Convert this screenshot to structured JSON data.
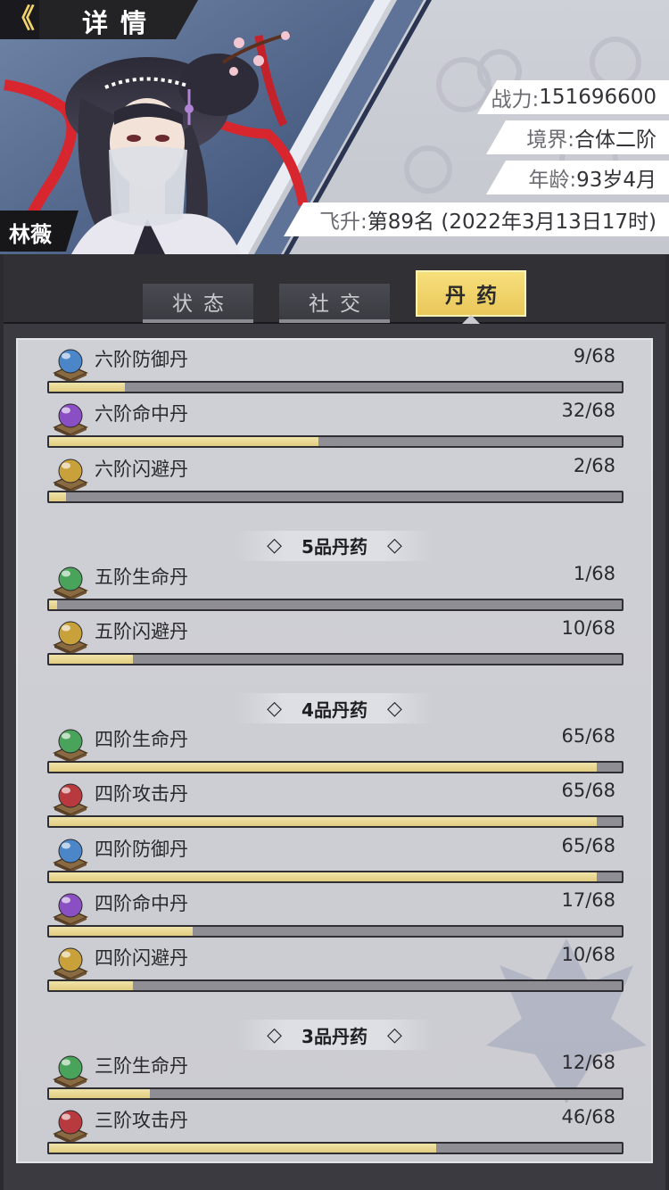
{
  "header": {
    "back_glyph": "《",
    "title": "详情",
    "character_name": "林薇",
    "stats": {
      "power_label": "战力:",
      "power_value": "151696600",
      "realm_label": "境界:",
      "realm_value": "合体二阶",
      "age_label": "年龄:",
      "age_value": "93岁4月",
      "ascend_label": "飞升:",
      "ascend_value": "第89名 (2022年3月13日17时)"
    }
  },
  "tabs": [
    {
      "label": "状态",
      "active": false
    },
    {
      "label": "社交",
      "active": false
    },
    {
      "label": "丹药",
      "active": true
    }
  ],
  "sections": [
    {
      "title": "",
      "items": [
        {
          "name": "六阶防御丹",
          "count": "9/68",
          "current": 9,
          "max": 68,
          "orb": "blue-pill-icon",
          "color": "#4a86c8"
        },
        {
          "name": "六阶命中丹",
          "count": "32/68",
          "current": 32,
          "max": 68,
          "orb": "purple-pill-icon",
          "color": "#8a4fc2"
        },
        {
          "name": "六阶闪避丹",
          "count": "2/68",
          "current": 2,
          "max": 68,
          "orb": "gold-pill-icon",
          "color": "#c9a13a"
        }
      ]
    },
    {
      "title": "5品丹药",
      "items": [
        {
          "name": "五阶生命丹",
          "count": "1/68",
          "current": 1,
          "max": 68,
          "orb": "green-pill-icon",
          "color": "#4aa35a"
        },
        {
          "name": "五阶闪避丹",
          "count": "10/68",
          "current": 10,
          "max": 68,
          "orb": "gold-pill-icon",
          "color": "#c9a13a"
        }
      ]
    },
    {
      "title": "4品丹药",
      "items": [
        {
          "name": "四阶生命丹",
          "count": "65/68",
          "current": 65,
          "max": 68,
          "orb": "green-pill-icon",
          "color": "#4aa35a"
        },
        {
          "name": "四阶攻击丹",
          "count": "65/68",
          "current": 65,
          "max": 68,
          "orb": "red-pill-icon",
          "color": "#b83a3e"
        },
        {
          "name": "四阶防御丹",
          "count": "65/68",
          "current": 65,
          "max": 68,
          "orb": "blue-pill-icon",
          "color": "#4a86c8"
        },
        {
          "name": "四阶命中丹",
          "count": "17/68",
          "current": 17,
          "max": 68,
          "orb": "purple-pill-icon",
          "color": "#8a4fc2"
        },
        {
          "name": "四阶闪避丹",
          "count": "10/68",
          "current": 10,
          "max": 68,
          "orb": "gold-pill-icon",
          "color": "#c9a13a"
        }
      ]
    },
    {
      "title": "3品丹药",
      "items": [
        {
          "name": "三阶生命丹",
          "count": "12/68",
          "current": 12,
          "max": 68,
          "orb": "green-pill-icon",
          "color": "#4aa35a"
        },
        {
          "name": "三阶攻击丹",
          "count": "46/68",
          "current": 46,
          "max": 68,
          "orb": "red-pill-icon",
          "color": "#b83a3e"
        }
      ]
    }
  ],
  "section_diamond": "◇"
}
